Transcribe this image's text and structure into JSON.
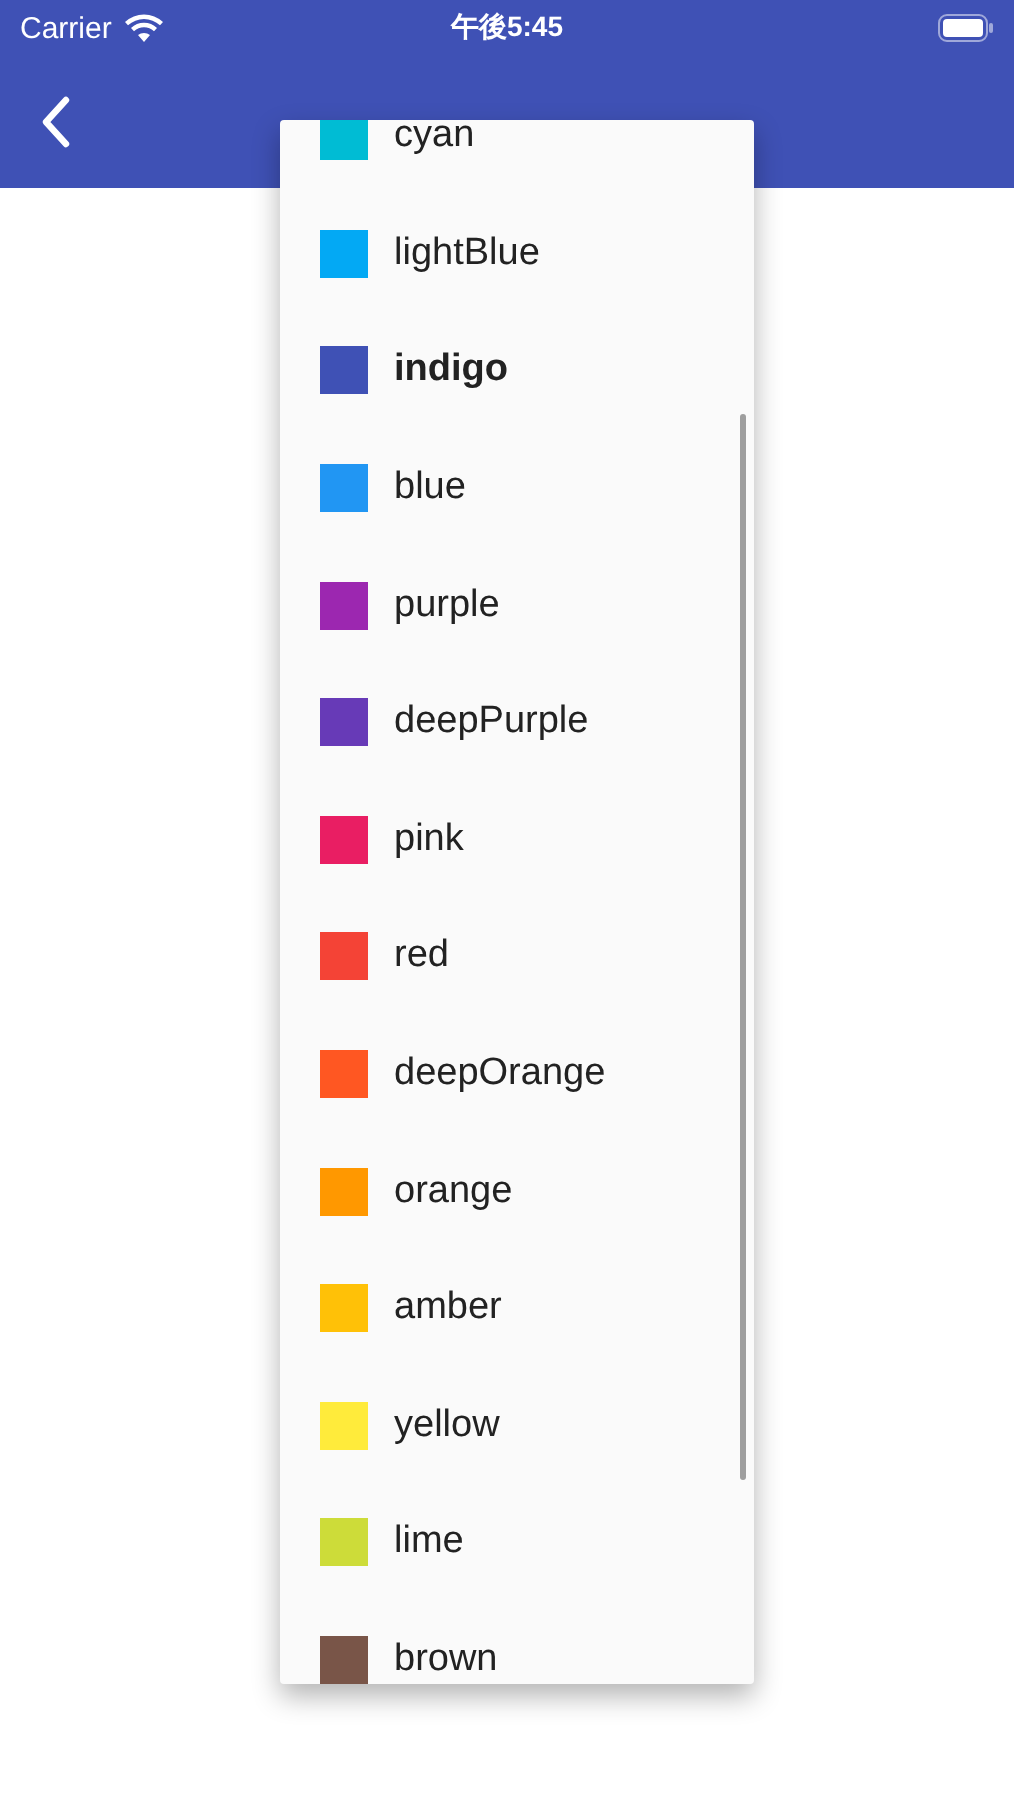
{
  "status_bar": {
    "carrier": "Carrier",
    "time": "午後5:45"
  },
  "menu": {
    "items": [
      {
        "label": "cyan",
        "color": "#00bcd4",
        "selected": false
      },
      {
        "label": "lightBlue",
        "color": "#03a9f4",
        "selected": false
      },
      {
        "label": "indigo",
        "color": "#3f51b5",
        "selected": true
      },
      {
        "label": "blue",
        "color": "#2196f3",
        "selected": false
      },
      {
        "label": "purple",
        "color": "#9c27b0",
        "selected": false
      },
      {
        "label": "deepPurple",
        "color": "#673ab7",
        "selected": false
      },
      {
        "label": "pink",
        "color": "#e91e63",
        "selected": false
      },
      {
        "label": "red",
        "color": "#f44336",
        "selected": false
      },
      {
        "label": "deepOrange",
        "color": "#ff5722",
        "selected": false
      },
      {
        "label": "orange",
        "color": "#ff9800",
        "selected": false
      },
      {
        "label": "amber",
        "color": "#ffc107",
        "selected": false
      },
      {
        "label": "yellow",
        "color": "#ffeb3b",
        "selected": false
      },
      {
        "label": "lime",
        "color": "#cddc39",
        "selected": false
      },
      {
        "label": "brown",
        "color": "#795548",
        "selected": false
      }
    ]
  }
}
